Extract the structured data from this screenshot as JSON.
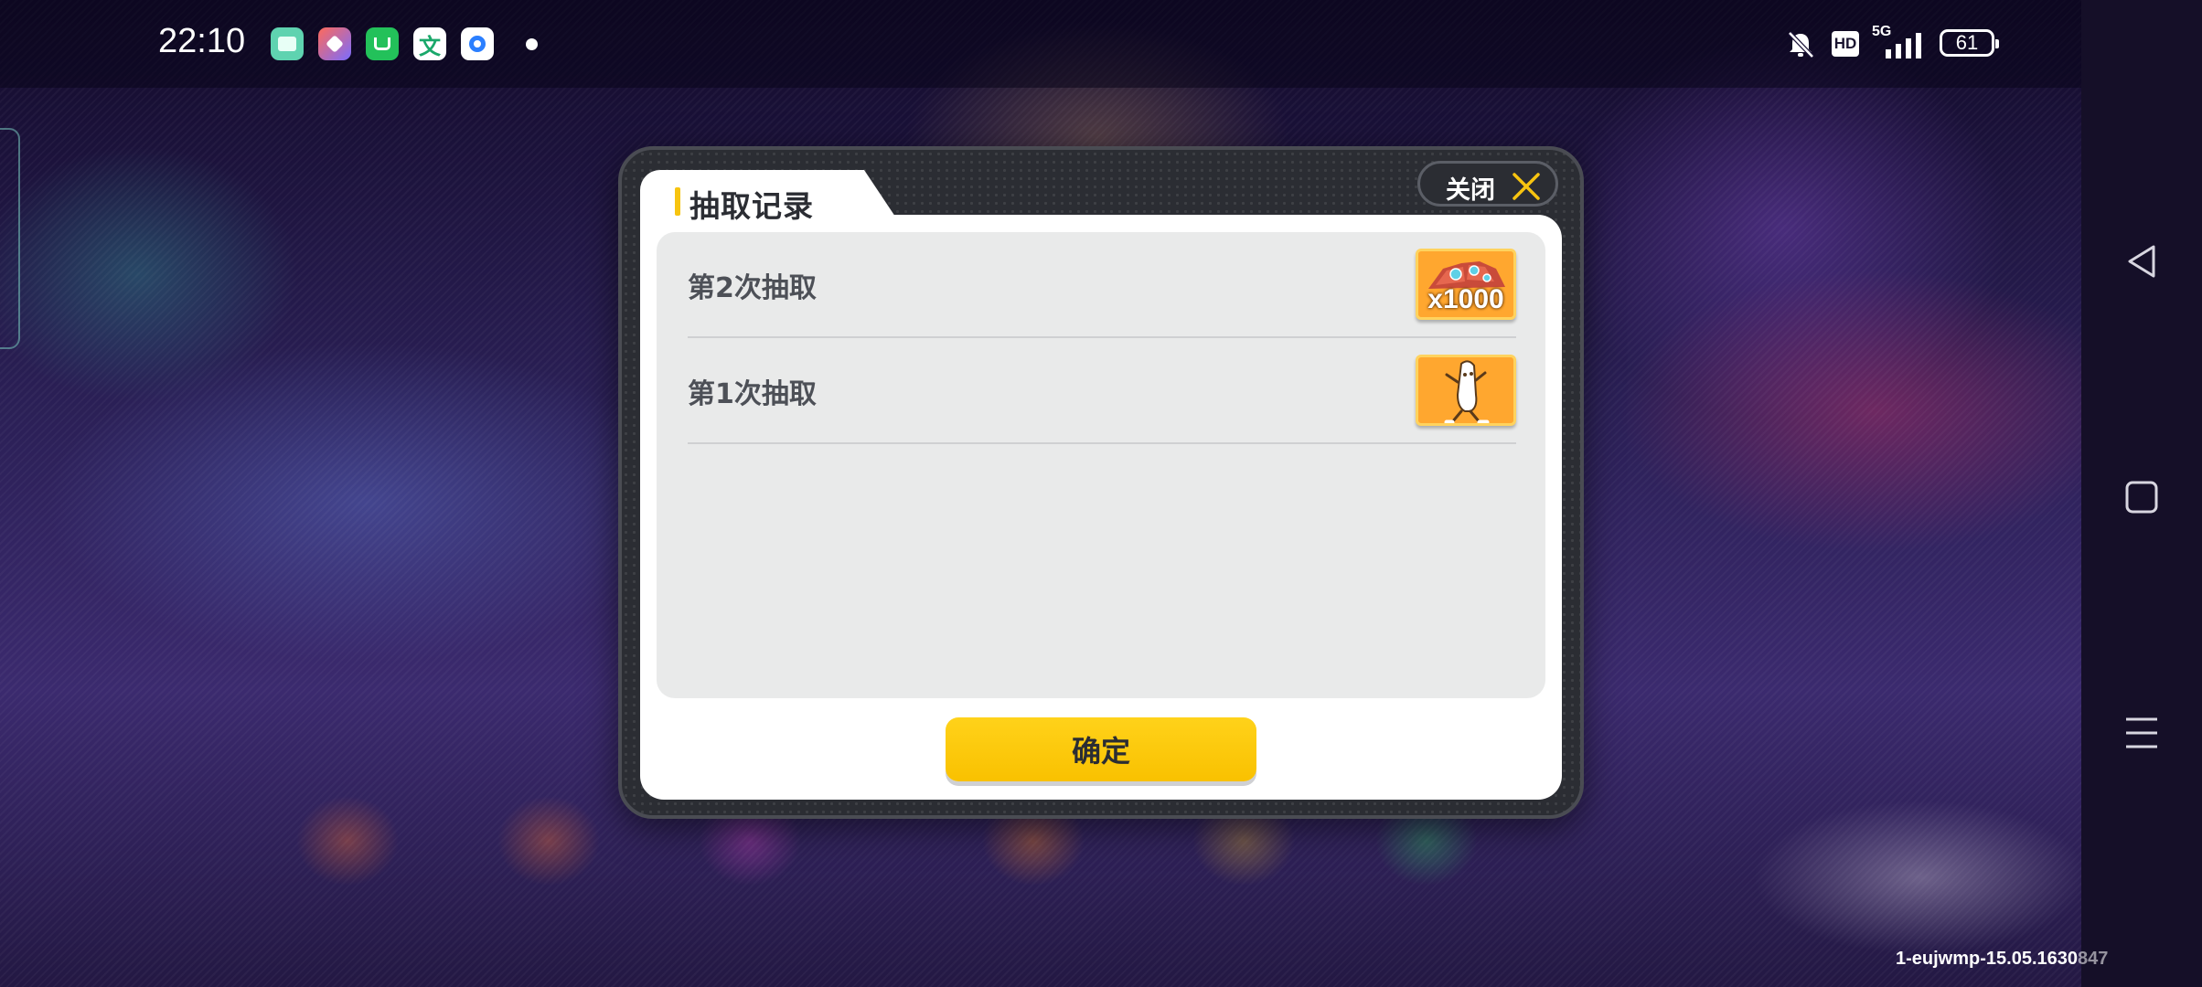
{
  "status_bar": {
    "time": "22:10",
    "network": "5G",
    "hd_badge": "HD",
    "battery_level": "61",
    "notification_icons": [
      "notes-app-icon",
      "wallet-app-icon",
      "store-app-icon",
      "translate-app-icon",
      "browser-app-icon"
    ]
  },
  "dialog": {
    "title": "抽取记录",
    "close_label": "关闭",
    "records": [
      {
        "label": "第2次抽取",
        "reward_icon": "gem-pile-icon",
        "reward_quantity": "x1000"
      },
      {
        "label": "第1次抽取",
        "reward_icon": "character-emote-icon",
        "reward_quantity": ""
      }
    ],
    "confirm_label": "确定"
  },
  "watermark": {
    "text": "1-eujwmp-15.05.1630",
    "suffix": "847"
  },
  "colors": {
    "accent_yellow": "#f9c100",
    "reward_orange": "#ffa72f",
    "frame_dark": "#2b2d33",
    "panel_grey": "#e9eaea"
  }
}
